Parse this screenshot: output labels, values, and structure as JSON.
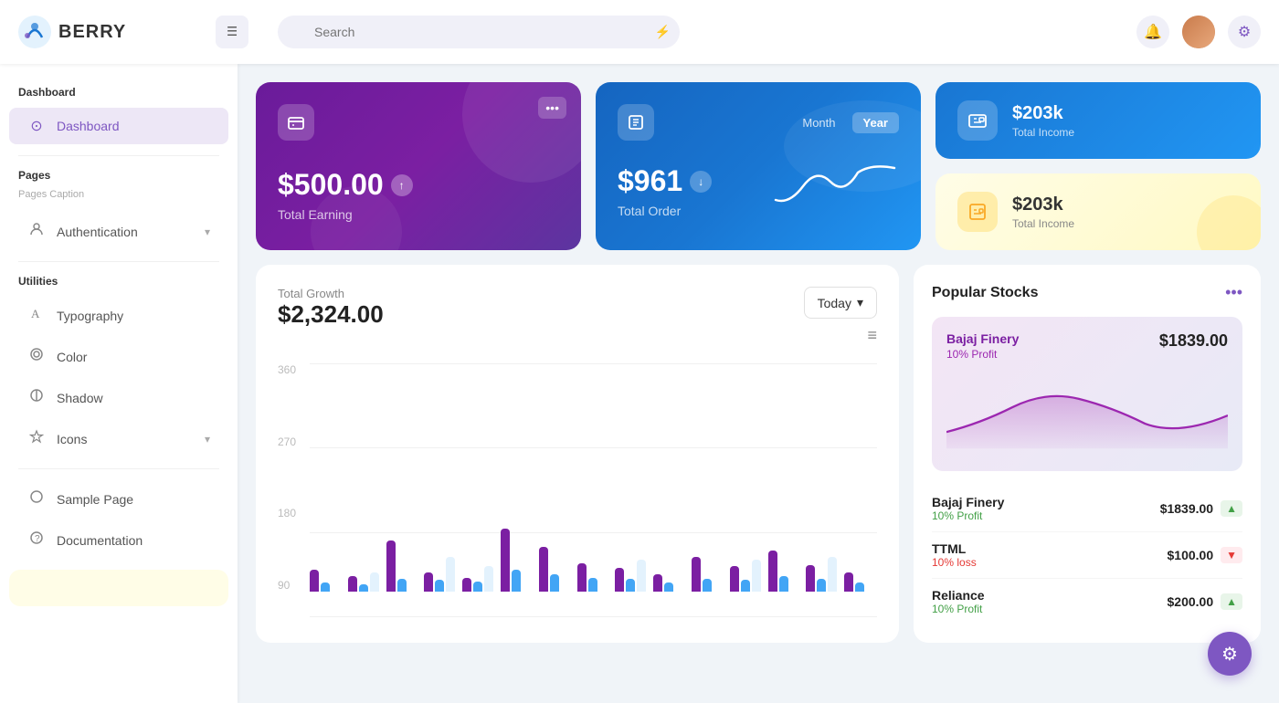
{
  "header": {
    "logo_text": "BERRY",
    "search_placeholder": "Search",
    "menu_icon": "☰",
    "bell_icon": "🔔",
    "settings_icon": "⚙"
  },
  "sidebar": {
    "sections": [
      {
        "label": "Dashboard",
        "items": [
          {
            "id": "dashboard",
            "icon": "⊙",
            "label": "Dashboard",
            "active": true
          }
        ]
      },
      {
        "label": "Pages",
        "sublabel": "Pages Caption",
        "items": [
          {
            "id": "authentication",
            "icon": "🔑",
            "label": "Authentication",
            "hasChevron": true
          },
          {
            "label_divider": ""
          }
        ]
      },
      {
        "label": "Utilities",
        "items": [
          {
            "id": "typography",
            "icon": "A",
            "label": "Typography"
          },
          {
            "id": "color",
            "icon": "◎",
            "label": "Color"
          },
          {
            "id": "shadow",
            "icon": "◉",
            "label": "Shadow"
          },
          {
            "id": "icons",
            "icon": "⊕",
            "label": "Icons",
            "hasChevron": true
          }
        ]
      },
      {
        "label": "",
        "items": [
          {
            "id": "sample-page",
            "icon": "◎",
            "label": "Sample Page"
          },
          {
            "id": "documentation",
            "icon": "?",
            "label": "Documentation"
          }
        ]
      }
    ]
  },
  "cards": {
    "total_earning": {
      "amount": "$500.00",
      "label": "Total Earning"
    },
    "total_order": {
      "amount": "$961",
      "label": "Total Order",
      "month_label": "Month",
      "year_label": "Year"
    },
    "income_blue": {
      "amount": "$203k",
      "label": "Total Income"
    },
    "income_yellow": {
      "amount": "$203k",
      "label": "Total Income"
    }
  },
  "chart": {
    "title": "Total Growth",
    "amount": "$2,324.00",
    "period_label": "Today",
    "y_labels": [
      "360",
      "270",
      "180",
      "90"
    ],
    "bars": [
      {
        "purple": 35,
        "blue": 15,
        "light": 0
      },
      {
        "purple": 25,
        "blue": 12,
        "light": 30
      },
      {
        "purple": 80,
        "blue": 20,
        "light": 0
      },
      {
        "purple": 30,
        "blue": 18,
        "light": 55
      },
      {
        "purple": 22,
        "blue": 16,
        "light": 40
      },
      {
        "purple": 100,
        "blue": 35,
        "light": 0
      },
      {
        "purple": 70,
        "blue": 28,
        "light": 0
      },
      {
        "purple": 45,
        "blue": 22,
        "light": 0
      },
      {
        "purple": 38,
        "blue": 20,
        "light": 50
      },
      {
        "purple": 28,
        "blue": 15,
        "light": 0
      },
      {
        "purple": 55,
        "blue": 20,
        "light": 0
      },
      {
        "purple": 40,
        "blue": 18,
        "light": 50
      },
      {
        "purple": 65,
        "blue": 25,
        "light": 0
      },
      {
        "purple": 42,
        "blue": 20,
        "light": 55
      },
      {
        "purple": 30,
        "blue": 14,
        "light": 0
      }
    ]
  },
  "stocks": {
    "title": "Popular Stocks",
    "featured": {
      "name": "Bajaj Finery",
      "profit_label": "10% Profit",
      "price": "$1839.00"
    },
    "list": [
      {
        "name": "Bajaj Finery",
        "percent": "10% Profit",
        "profit": true,
        "price": "$1839.00"
      },
      {
        "name": "TTML",
        "percent": "10% loss",
        "profit": false,
        "price": "$100.00"
      },
      {
        "name": "Reliance",
        "percent": "10% Profit",
        "profit": true,
        "price": "$200.00"
      }
    ]
  },
  "fab": {
    "icon": "⚙"
  }
}
